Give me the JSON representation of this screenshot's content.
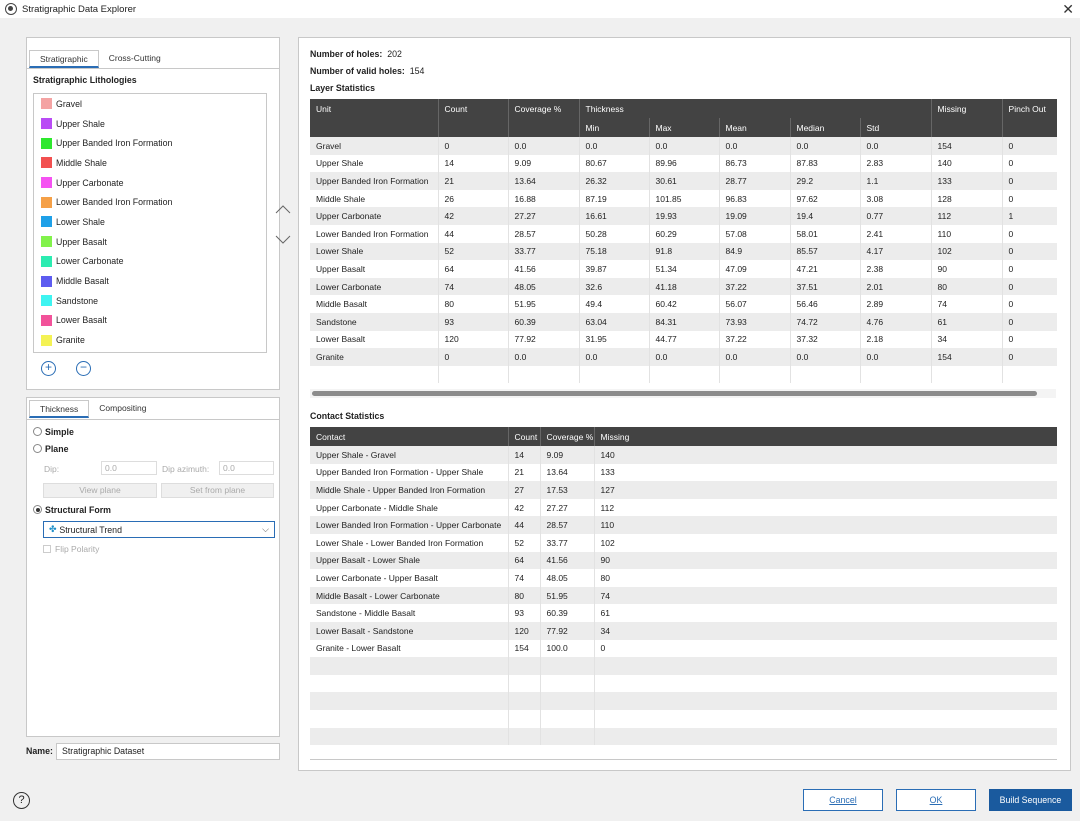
{
  "window": {
    "title": "Stratigraphic Data Explorer"
  },
  "left_tabs": [
    "Stratigraphic",
    "Cross-Cutting"
  ],
  "lithologies_title": "Stratigraphic Lithologies",
  "lithologies": [
    {
      "name": "Gravel",
      "color": "#f4a3a3"
    },
    {
      "name": "Upper Shale",
      "color": "#b94cf5"
    },
    {
      "name": "Upper Banded Iron Formation",
      "color": "#2ee82e"
    },
    {
      "name": "Middle Shale",
      "color": "#f25050"
    },
    {
      "name": "Upper Carbonate",
      "color": "#f552f2"
    },
    {
      "name": "Lower Banded Iron Formation",
      "color": "#f5a047"
    },
    {
      "name": "Lower Shale",
      "color": "#1ea0e8"
    },
    {
      "name": "Upper Basalt",
      "color": "#82f24b"
    },
    {
      "name": "Lower Carbonate",
      "color": "#2cecb1"
    },
    {
      "name": "Middle Basalt",
      "color": "#5d5cf0"
    },
    {
      "name": "Sandstone",
      "color": "#3ef4f1"
    },
    {
      "name": "Lower Basalt",
      "color": "#f2529a"
    },
    {
      "name": "Granite",
      "color": "#f4f254"
    }
  ],
  "thickness_tabs": [
    "Thickness",
    "Compositing"
  ],
  "thickness": {
    "simple": "Simple",
    "plane": "Plane",
    "dip_label": "Dip:",
    "dip_value": "0.0",
    "dip_azimuth_label": "Dip azimuth:",
    "dip_azimuth_value": "0.0",
    "view_plane": "View plane",
    "set_from_plane": "Set from plane",
    "structural_form": "Structural Form",
    "structural_trend": "Structural Trend",
    "flip_polarity": "Flip Polarity"
  },
  "name_label": "Name:",
  "name_value": "Stratigraphic Dataset",
  "summary": {
    "holes_label": "Number of holes:",
    "holes_value": "202",
    "valid_label": "Number of valid holes:",
    "valid_value": "154"
  },
  "layer_stats": {
    "title": "Layer Statistics",
    "headers": [
      "Unit",
      "Count",
      "Coverage %",
      "Thickness",
      "Missing",
      "Pinch Out"
    ],
    "sub_headers": [
      "Min",
      "Max",
      "Mean",
      "Median",
      "Std"
    ],
    "rows": [
      [
        "Gravel",
        "0",
        "0.0",
        "0.0",
        "0.0",
        "0.0",
        "0.0",
        "0.0",
        "154",
        "0"
      ],
      [
        "Upper Shale",
        "14",
        "9.09",
        "80.67",
        "89.96",
        "86.73",
        "87.83",
        "2.83",
        "140",
        "0"
      ],
      [
        "Upper Banded Iron Formation",
        "21",
        "13.64",
        "26.32",
        "30.61",
        "28.77",
        "29.2",
        "1.1",
        "133",
        "0"
      ],
      [
        "Middle Shale",
        "26",
        "16.88",
        "87.19",
        "101.85",
        "96.83",
        "97.62",
        "3.08",
        "128",
        "0"
      ],
      [
        "Upper Carbonate",
        "42",
        "27.27",
        "16.61",
        "19.93",
        "19.09",
        "19.4",
        "0.77",
        "112",
        "1"
      ],
      [
        "Lower Banded Iron Formation",
        "44",
        "28.57",
        "50.28",
        "60.29",
        "57.08",
        "58.01",
        "2.41",
        "110",
        "0"
      ],
      [
        "Lower Shale",
        "52",
        "33.77",
        "75.18",
        "91.8",
        "84.9",
        "85.57",
        "4.17",
        "102",
        "0"
      ],
      [
        "Upper Basalt",
        "64",
        "41.56",
        "39.87",
        "51.34",
        "47.09",
        "47.21",
        "2.38",
        "90",
        "0"
      ],
      [
        "Lower Carbonate",
        "74",
        "48.05",
        "32.6",
        "41.18",
        "37.22",
        "37.51",
        "2.01",
        "80",
        "0"
      ],
      [
        "Middle Basalt",
        "80",
        "51.95",
        "49.4",
        "60.42",
        "56.07",
        "56.46",
        "2.89",
        "74",
        "0"
      ],
      [
        "Sandstone",
        "93",
        "60.39",
        "63.04",
        "84.31",
        "73.93",
        "74.72",
        "4.76",
        "61",
        "0"
      ],
      [
        "Lower Basalt",
        "120",
        "77.92",
        "31.95",
        "44.77",
        "37.22",
        "37.32",
        "2.18",
        "34",
        "0"
      ],
      [
        "Granite",
        "0",
        "0.0",
        "0.0",
        "0.0",
        "0.0",
        "0.0",
        "0.0",
        "154",
        "0"
      ]
    ]
  },
  "contact_stats": {
    "title": "Contact Statistics",
    "headers": [
      "Contact",
      "Count",
      "Coverage %",
      "Missing"
    ],
    "rows": [
      [
        "Upper Shale - Gravel",
        "14",
        "9.09",
        "140"
      ],
      [
        "Upper Banded Iron Formation - Upper Shale",
        "21",
        "13.64",
        "133"
      ],
      [
        "Middle Shale - Upper Banded Iron Formation",
        "27",
        "17.53",
        "127"
      ],
      [
        "Upper Carbonate - Middle Shale",
        "42",
        "27.27",
        "112"
      ],
      [
        "Lower Banded Iron Formation - Upper Carbonate",
        "44",
        "28.57",
        "110"
      ],
      [
        "Lower Shale - Lower Banded Iron Formation",
        "52",
        "33.77",
        "102"
      ],
      [
        "Upper Basalt - Lower Shale",
        "64",
        "41.56",
        "90"
      ],
      [
        "Lower Carbonate - Upper Basalt",
        "74",
        "48.05",
        "80"
      ],
      [
        "Middle Basalt - Lower Carbonate",
        "80",
        "51.95",
        "74"
      ],
      [
        "Sandstone - Middle Basalt",
        "93",
        "60.39",
        "61"
      ],
      [
        "Lower Basalt - Sandstone",
        "120",
        "77.92",
        "34"
      ],
      [
        "Granite - Lower Basalt",
        "154",
        "100.0",
        "0"
      ]
    ]
  },
  "footer": {
    "help": "?",
    "cancel": "Cancel",
    "ok": "OK",
    "build": "Build Sequence"
  }
}
